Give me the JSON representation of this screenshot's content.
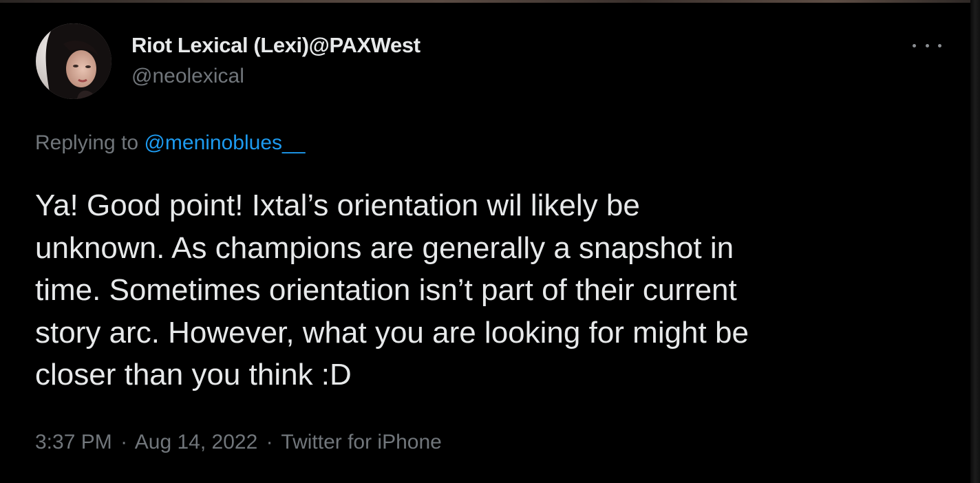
{
  "tweet": {
    "author": {
      "display_name": "Riot Lexical (Lexi)@PAXWest",
      "handle": "@neolexical",
      "avatar_icon": "profile-photo"
    },
    "more_icon": "more-options-icon",
    "replying": {
      "prefix": "Replying to",
      "mention": "@meninoblues__"
    },
    "text_lines": [
      "Ya! Good point! Ixtal’s orientation wil likely be",
      "unknown. As champions are generally a snapshot in",
      "time. Sometimes orientation isn’t part of their current",
      "story arc. However, what you are looking for might be",
      "closer than you think :D"
    ],
    "meta": {
      "time": "3:37 PM",
      "separator": "·",
      "date": "Aug 14, 2022",
      "source": "Twitter for iPhone"
    }
  },
  "colors": {
    "background": "#000000",
    "primary_text": "#e7e9ea",
    "secondary_text": "#71767b",
    "link": "#1d9bf0"
  }
}
